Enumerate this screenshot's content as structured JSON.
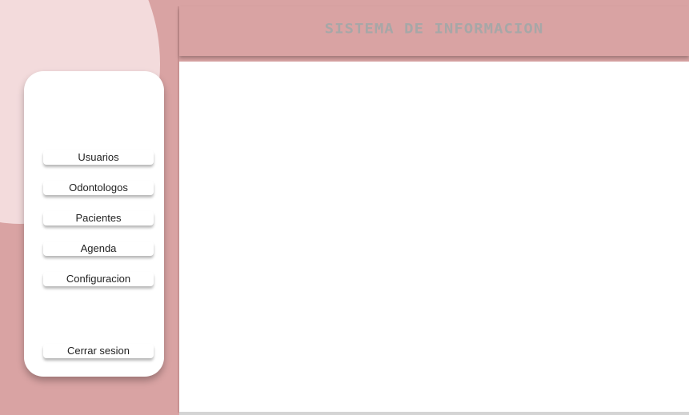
{
  "header": {
    "title": "SISTEMA DE INFORMACION"
  },
  "sidebar": {
    "items": [
      {
        "label": "Usuarios"
      },
      {
        "label": "Odontologos"
      },
      {
        "label": "Pacientes"
      },
      {
        "label": "Agenda"
      },
      {
        "label": "Configuracion"
      }
    ],
    "logout_label": "Cerrar sesion"
  },
  "colors": {
    "brand": "#d9a3a3",
    "accent_light": "#f3dbdc",
    "title_text": "#a7a7a7",
    "content_bg": "#ffffff"
  }
}
